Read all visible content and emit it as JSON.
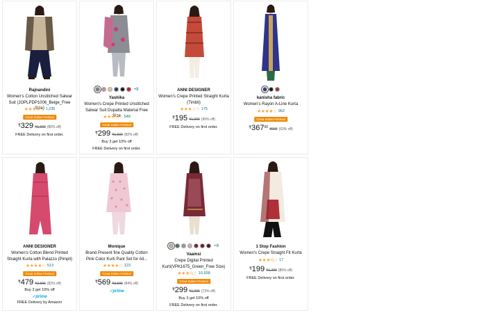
{
  "products": [
    {
      "brand": "Rajnandini",
      "title": "Women's Cotton Unstitched Salwar Suit (JOPLPDP1006_Beige_Free Size)",
      "stars": "★★★★☆",
      "rating_count": "1,235",
      "badge": "Great Indian Festival",
      "currency": "₹",
      "price": "329",
      "mrp": "₹1,699",
      "off": "(80% off)",
      "delivery": "FREE Delivery on first order."
    },
    {
      "brand": "Yashika",
      "title": "Women's Crepe Printed Unstitched Salwar Suit Dupatta Material Free Size",
      "stars": "★★★½☆",
      "rating_count": "548",
      "badge": "Great Indian Festival",
      "currency": "₹",
      "price": "299",
      "mrp": "₹1,699",
      "off": "(82% off)",
      "offer": "Buy 3 get 10% off",
      "delivery": "FREE Delivery on first order.",
      "swatches": [
        "#7a7f86",
        "#c78aa2",
        "#d6c98a",
        "#2e3d6b",
        "#1a1a1a",
        "#c01c2c"
      ],
      "swatch_more": "+9"
    },
    {
      "brand": "ANNI DESIGNER",
      "title": "Women's Crepe Printed Straight Kurta (Timbli)",
      "stars": "★★★☆☆",
      "rating_count": "175",
      "currency": "₹",
      "price": "195",
      "mrp": "₹1,999",
      "off": "(90% off)",
      "delivery": "FREE Delivery on first order."
    },
    {
      "brand": "kanisha fabric",
      "title": "Women's Rayon A-Line Kurta",
      "stars": "★★★★☆",
      "rating_count": "962",
      "badge": "Great Indian Festival",
      "currency": "₹",
      "price": "367",
      "paise": "00",
      "mrp": "₹999",
      "off": "(63% off)",
      "swatches": [
        "#2d3a8a",
        "#1a1a1a",
        "#b03030"
      ]
    },
    {
      "brand": "ANNI DESIGNER",
      "title": "Women's Cotton Blend Printed Straight Kurta with Palazzo (Pimpli)",
      "stars": "★★★★☆",
      "rating_count": "513",
      "badge": "Great Indian Festival",
      "currency": "₹",
      "price": "479",
      "mrp": "₹2,699",
      "off": "(82% off)",
      "offer": "Buy 3 get 10% off",
      "prime": "✓prime",
      "delivery": "FREE Delivery by Amazon"
    },
    {
      "brand": "Monique",
      "title": "Brand Present fine Quality Cotton Pink Color Kurti Pant Set for All...",
      "stars": "★★★★☆",
      "rating_count": "123",
      "badge": "Great Indian Festival",
      "currency": "₹",
      "price": "569",
      "mrp": "₹3,599",
      "off": "(84% off)",
      "prime": "✓prime"
    },
    {
      "brand": "Vaamsi",
      "title": "Crepe Digital Printed Kurti(VPK1675_Green_Free Size)",
      "stars": "★★★½☆",
      "rating_count": "10,938",
      "badge": "Great Indian Festival",
      "currency": "₹",
      "price": "299",
      "mrp": "₹1,099",
      "off": "(73% off)",
      "offer": "Buy 3 get 10% off",
      "delivery": "FREE Delivery on first order.",
      "swatches": [
        "#a8b79a",
        "#4e6e5e",
        "#8a9aa8",
        "#c8a8b0",
        "#6a2a3a",
        "#7a1a2a",
        "#4a1a24"
      ],
      "swatch_more": "+8"
    },
    {
      "brand": "1 Stop Fashion",
      "title": "Women's Crepe Straight Fit Kurta",
      "stars": "★★★½☆",
      "rating_count": "17",
      "currency": "₹",
      "price": "199",
      "mrp": "₹1,299",
      "off": "(85% off)",
      "delivery": "FREE Delivery on first order."
    }
  ]
}
